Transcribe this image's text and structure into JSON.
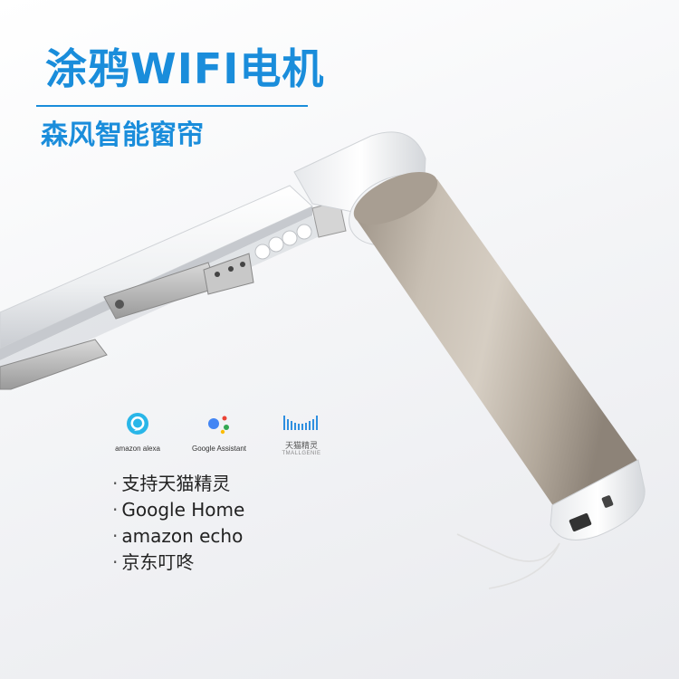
{
  "headline": {
    "title": "涂鸦WIFI电机",
    "subtitle": "森风智能窗帘"
  },
  "logos": [
    {
      "name": "alexa-logo",
      "label": "amazon alexa"
    },
    {
      "name": "google-assistant-logo",
      "label": "Google Assistant"
    },
    {
      "name": "tmall-genie-logo",
      "label_cn": "天猫精灵",
      "label_en": "TMALLGENIE"
    }
  ],
  "features": [
    "支持天猫精灵",
    "Google Home",
    "amazon echo",
    "京东叮咚"
  ],
  "colors": {
    "accent": "#1a8ddb",
    "motor_body": "#b8aea1",
    "rail": "#f5f5f5"
  }
}
